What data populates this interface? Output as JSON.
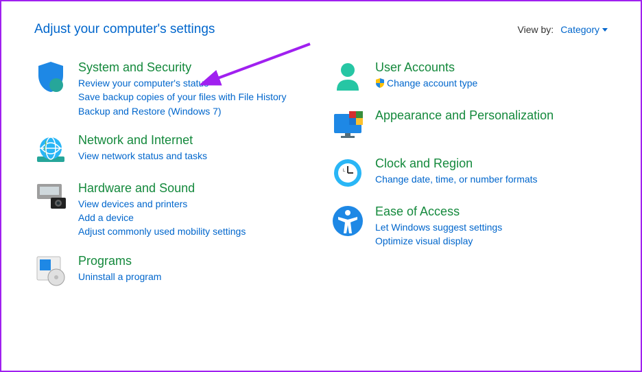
{
  "header": {
    "title": "Adjust your computer's settings",
    "viewby_label": "View by:",
    "viewby_value": "Category"
  },
  "left": [
    {
      "title": "System and Security",
      "links": [
        "Review your computer's status",
        "Save backup copies of your files with File History",
        "Backup and Restore (Windows 7)"
      ]
    },
    {
      "title": "Network and Internet",
      "links": [
        "View network status and tasks"
      ]
    },
    {
      "title": "Hardware and Sound",
      "links": [
        "View devices and printers",
        "Add a device",
        "Adjust commonly used mobility settings"
      ]
    },
    {
      "title": "Programs",
      "links": [
        "Uninstall a program"
      ]
    }
  ],
  "right": [
    {
      "title": "User Accounts",
      "links": [
        "Change account type"
      ],
      "shield_on_first": true
    },
    {
      "title": "Appearance and Personalization",
      "links": []
    },
    {
      "title": "Clock and Region",
      "links": [
        "Change date, time, or number formats"
      ]
    },
    {
      "title": "Ease of Access",
      "links": [
        "Let Windows suggest settings",
        "Optimize visual display"
      ]
    }
  ]
}
